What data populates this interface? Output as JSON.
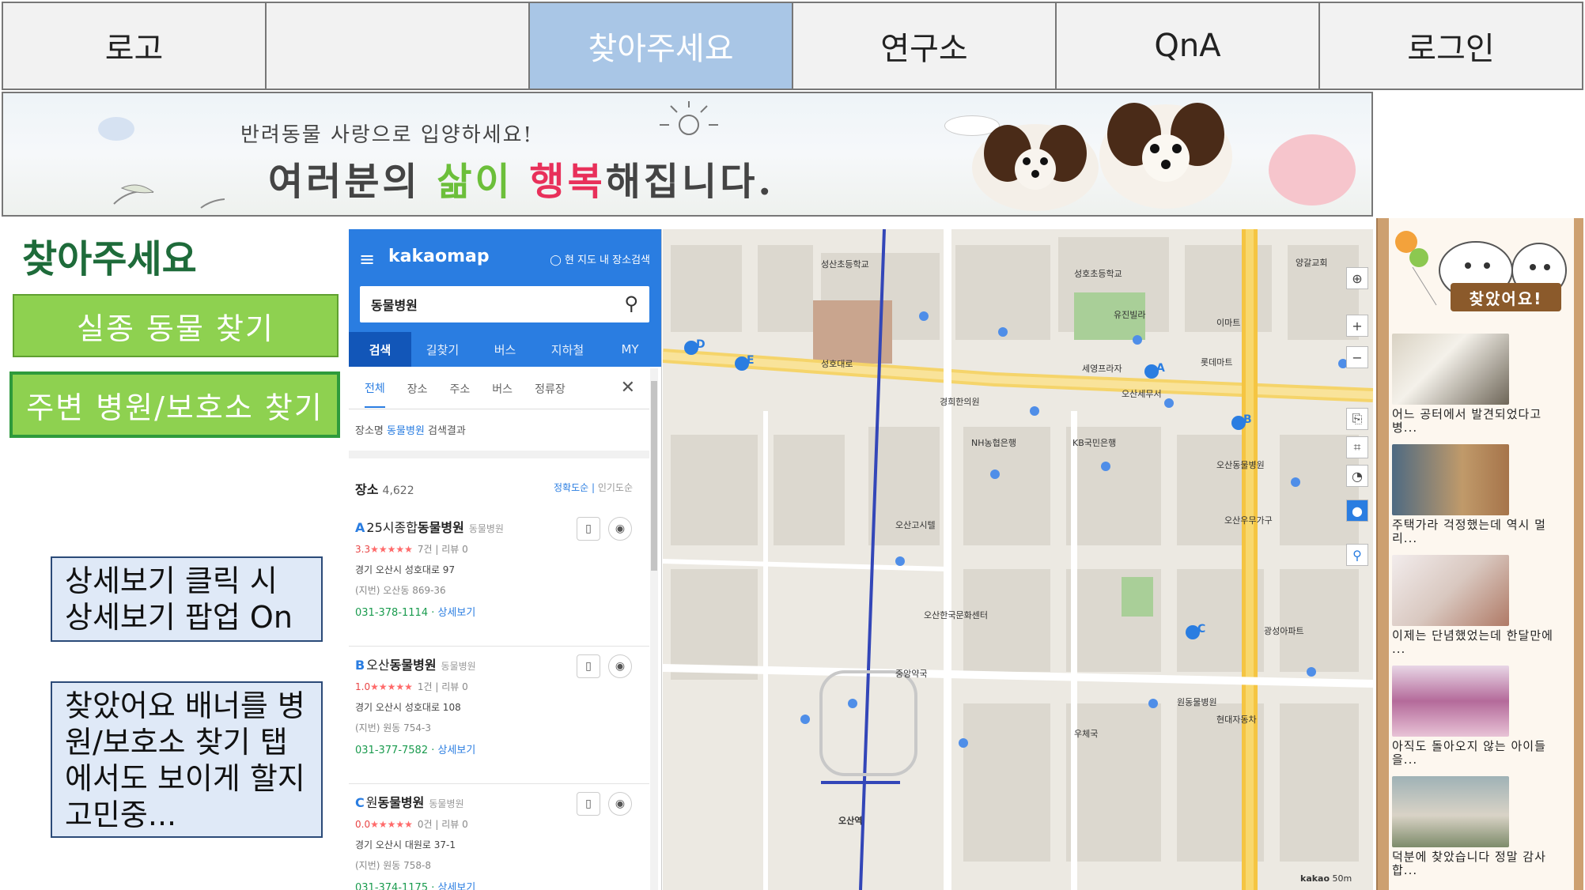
{
  "nav": {
    "logo": "로고",
    "find": "찾아주세요",
    "lab": "연구소",
    "qna": "QnA",
    "login": "로그인"
  },
  "banner": {
    "line1": "반려동물 사랑으로 입양하세요!",
    "line2_a": "여러분의",
    "line2_b": "삶이",
    "line2_c": "행복",
    "line2_d": "해집니다."
  },
  "left": {
    "title": "찾아주세요",
    "btn_missing": "실종 동물 찾기",
    "btn_hospital": "주변 병원/보호소 찾기",
    "note1": "상세보기 클릭 시 상세보기 팝업 On",
    "note2": "찾았어요 배너를 병원/보호소 찾기 탭에서도 보이게 할지 고민중..."
  },
  "kakao": {
    "logo": "kakaomap",
    "map_search": "◯ 현 지도 내 장소검색",
    "query": "동물병원",
    "tabs": [
      "검색",
      "길찾기",
      "버스",
      "지하철",
      "MY"
    ],
    "subtabs": [
      "전체",
      "장소",
      "주소",
      "버스",
      "정류장"
    ],
    "result_label_a": "장소명",
    "result_label_b": "동물병원",
    "result_label_c": "검색결과",
    "place_label": "장소",
    "place_count": "4,622",
    "sort_a": "정확도순",
    "sort_b": "인기도순",
    "results": [
      {
        "letter": "A",
        "name_a": "25시종합",
        "name_b": "동물병원",
        "cat": "동물병원",
        "score": "3.3",
        "stars": "★★★★★",
        "reviews": "7건 | 리뷰 0",
        "addr": "경기 오산시 성호대로 97",
        "jibun": "(지번) 오산동 869-36",
        "phone": "031-378-1114",
        "detail": "상세보기"
      },
      {
        "letter": "B",
        "name_a": "오산",
        "name_b": "동물병원",
        "cat": "동물병원",
        "score": "1.0",
        "stars": "★★★★★",
        "reviews": "1건 | 리뷰 0",
        "addr": "경기 오산시 성호대로 108",
        "jibun": "(지번) 원동 754-3",
        "phone": "031-377-7582",
        "detail": "상세보기"
      },
      {
        "letter": "C",
        "name_a": "원",
        "name_b": "동물병원",
        "cat": "동물병원",
        "score": "0.0",
        "stars": "★★★★★",
        "reviews": "0건 | 리뷰 0",
        "addr": "경기 오산시 대원로 37-1",
        "jibun": "(지번) 원동 758-8",
        "phone": "031-374-1175",
        "detail": "상세보기"
      }
    ]
  },
  "map": {
    "labels": [
      "오산역",
      "성호초등학교",
      "성산초등학교",
      "오산동물병원",
      "원동물병원",
      "오산고시텔",
      "경희한의원",
      "롯데마트",
      "세영프라자",
      "KB국민은행",
      "NH농협은행",
      "오산세무서",
      "중앙약국",
      "이마트",
      "우체국",
      "현대자동차",
      "오산한국문화센터",
      "성호대로",
      "오산우무가구",
      "광성아파트",
      "양갈교회",
      "유진빌라"
    ],
    "markers": [
      "A",
      "B",
      "C",
      "D",
      "E"
    ],
    "kakao_brand": "kakao",
    "scale": "50m"
  },
  "sidebar": {
    "title": "찾았어요!",
    "items": [
      {
        "caption": "어느 공터에서 발견되었다고 병..."
      },
      {
        "caption": "주택가라 걱정했는데 역시 멀리..."
      },
      {
        "caption": "이제는 단념했었는데 한달만에 ..."
      },
      {
        "caption": "아직도 돌아오지 않는 아이들을..."
      },
      {
        "caption": "덕분에 찾았습니다 정말 감사합..."
      }
    ]
  },
  "colors": {
    "nav_active": "#a9c6e6",
    "green_button": "#8ed150",
    "kakao_blue": "#2a7de1",
    "note_bg": "#dfe9f7"
  }
}
